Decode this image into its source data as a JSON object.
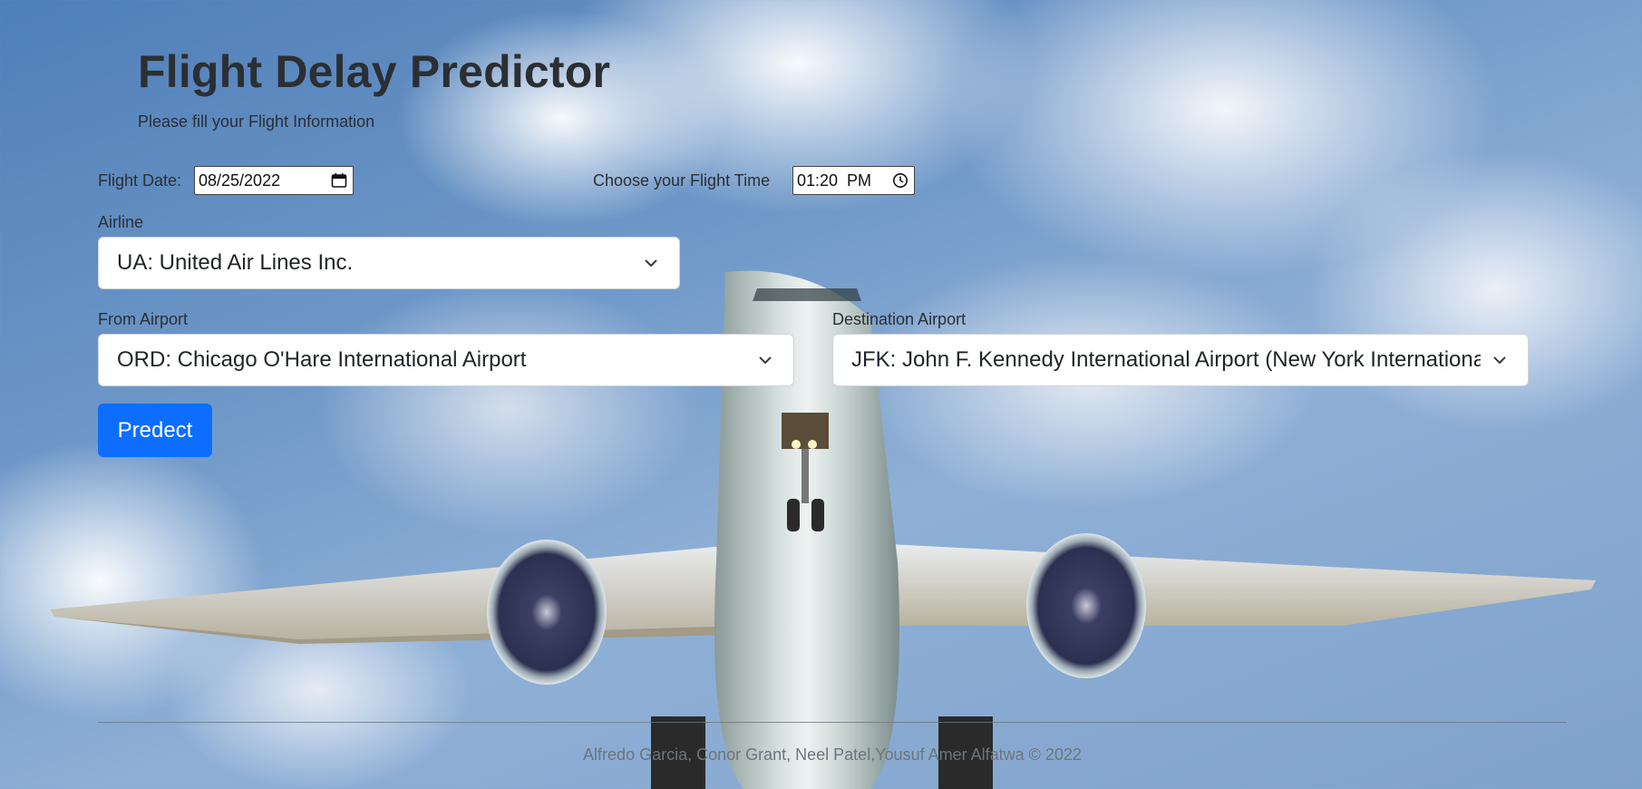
{
  "header": {
    "title": "Flight Delay Predictor",
    "subtitle": "Please fill your Flight Information"
  },
  "form": {
    "date_label": "Flight Date:",
    "date_value": "08/25/2022",
    "time_label": "Choose your Flight Time",
    "time_value": "01:20  PM",
    "airline_label": "Airline",
    "airline_value": "UA: United Air Lines Inc.",
    "from_label": "From Airport",
    "from_value": "ORD: Chicago O'Hare International Airport",
    "dest_label": "Destination Airport",
    "dest_value": "JFK: John F. Kennedy International Airport (New York International Airport)",
    "submit_label": "Predect"
  },
  "footer": {
    "text": "Alfredo Garcia, Conor Grant, Neel Patel,Yousuf Amer Alfatwa © 2022"
  },
  "colors": {
    "primary_button": "#0d6efd",
    "heading": "#2b2f33",
    "footer_text": "#6c757d"
  },
  "icons": [
    "calendar-icon",
    "clock-icon",
    "chevron-down-icon"
  ]
}
